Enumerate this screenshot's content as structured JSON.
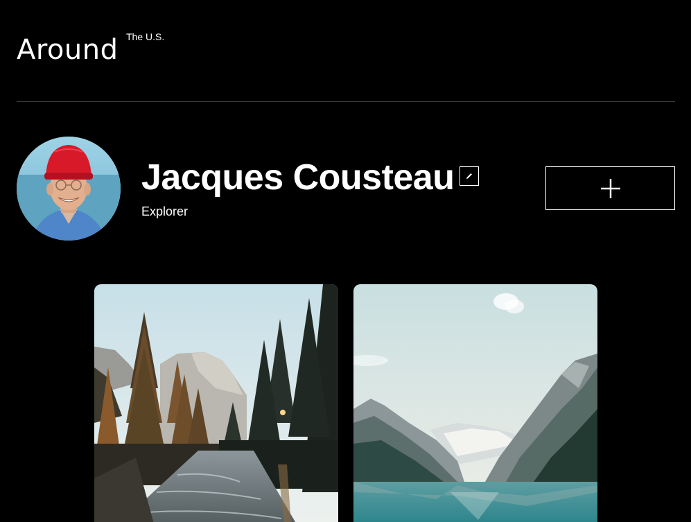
{
  "header": {
    "logo_text": "Around",
    "logo_superscript": "The U.S."
  },
  "profile": {
    "name": "Jacques Cousteau",
    "job": "Explorer",
    "avatar_icon": "avatar-photo",
    "edit_icon": "pencil-icon",
    "add_icon": "plus-icon"
  },
  "cards": [
    {
      "image": "forest-river-photo"
    },
    {
      "image": "mountain-lake-photo"
    }
  ],
  "colors": {
    "background": "#000000",
    "text": "#ffffff",
    "divider": "#3a3a3a",
    "avatar_hat": "#d8192a",
    "lake": "#2f8a8f"
  }
}
